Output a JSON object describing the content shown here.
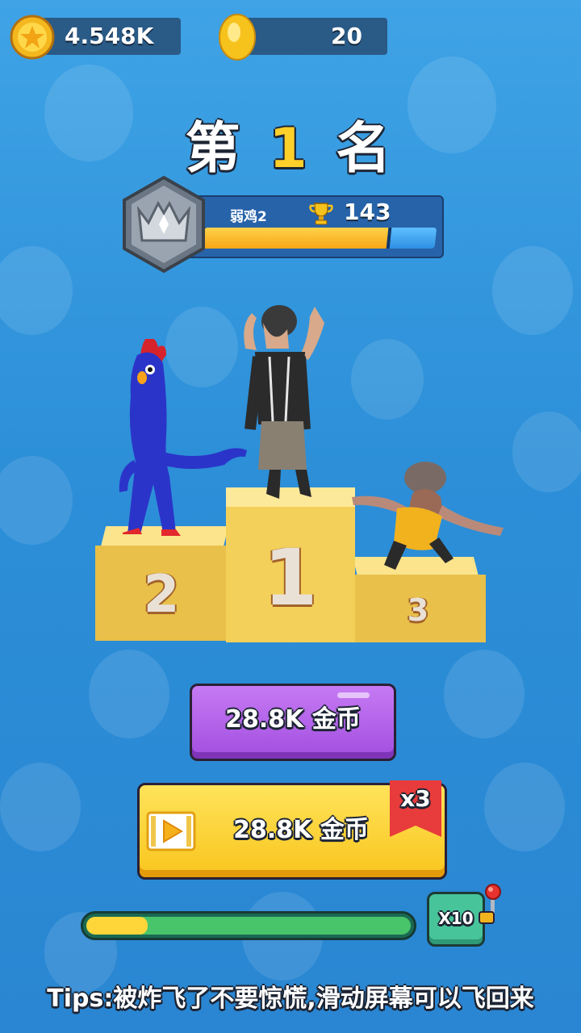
{
  "top_bar": {
    "star_coins": "4.548K",
    "gold_coins": "20"
  },
  "rank": {
    "prefix": "第",
    "number": "1",
    "suffix": "名"
  },
  "profile": {
    "player_name": "弱鸡2",
    "trophies": "143",
    "xp_progress": 0.79
  },
  "podium": {
    "first": "1",
    "second": "2",
    "third": "3"
  },
  "buttons": {
    "claim_label": "28.8K 金币",
    "video_claim_label": "28.8K 金币",
    "multiplier_badge": "x3"
  },
  "bonus": {
    "progress": 0.19,
    "multiplier_label": "X10"
  },
  "tips": "Tips:被炸飞了不要惊慌,滑动屏幕可以飞回来",
  "colors": {
    "background": "#2c8fd8",
    "podium": "#f0cb52",
    "purple_button": "#a24ee0",
    "yellow_button": "#f9c51d",
    "ribbon": "#e83b3b"
  }
}
